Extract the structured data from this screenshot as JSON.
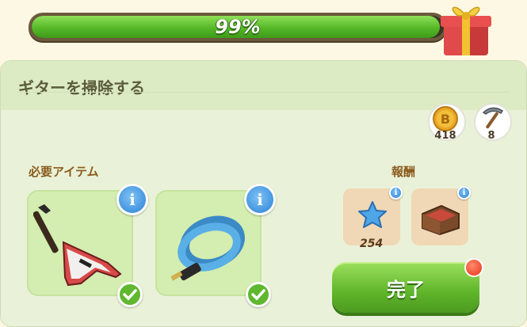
{
  "progress": {
    "value": 0.99,
    "label": "99%"
  },
  "quest": {
    "title": "ギターを掃除する"
  },
  "stats": {
    "coins": "418",
    "pickaxe": "8"
  },
  "required": {
    "label": "必要アイテム",
    "items": [
      {
        "name": "guitar",
        "info": "i"
      },
      {
        "name": "cable",
        "info": "i"
      }
    ]
  },
  "rewards": {
    "label": "報酬",
    "items": [
      {
        "name": "star",
        "value": "254"
      },
      {
        "name": "crate",
        "value": ""
      }
    ]
  },
  "complete_button": {
    "label": "完了"
  },
  "colors": {
    "accent_green": "#5fb52a",
    "info_blue": "#2a80d6",
    "notif_red": "#e8321a"
  }
}
